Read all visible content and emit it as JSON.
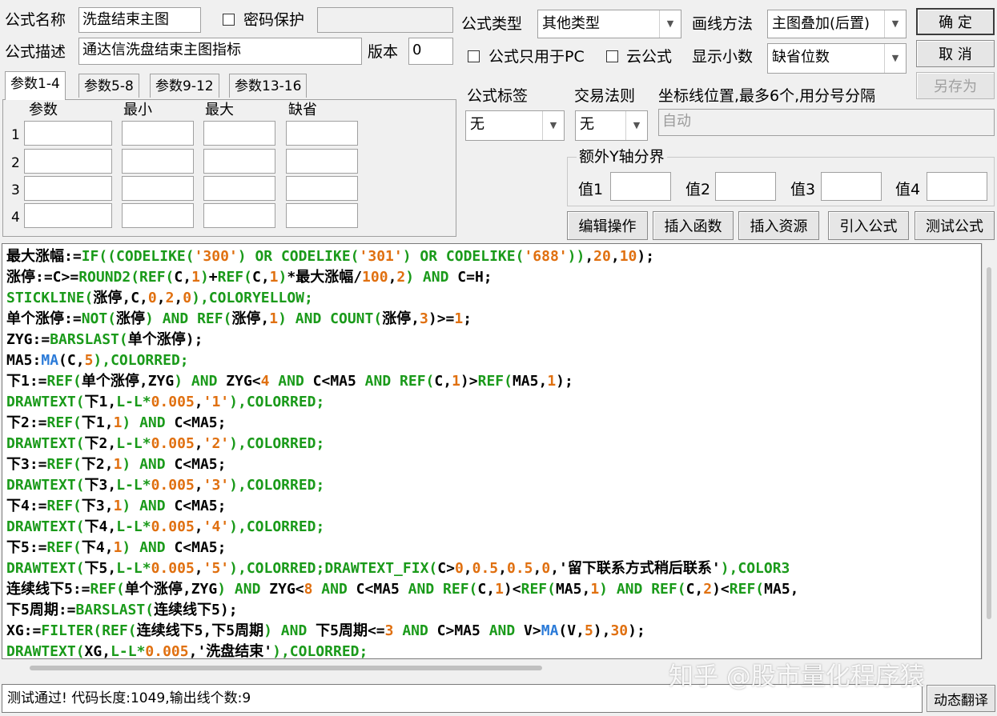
{
  "header": {
    "name_label": "公式名称",
    "name_value": "洗盘结束主图",
    "password_label": "密码保护",
    "password_value": "",
    "type_label": "公式类型",
    "type_value": "其他类型",
    "draw_label": "画线方法",
    "draw_value": "主图叠加(后置)",
    "desc_label": "公式描述",
    "desc_value": "通达信洗盘结束主图指标",
    "version_label": "版本",
    "version_value": "0",
    "pc_only_label": "公式只用于PC",
    "cloud_label": "云公式",
    "decimals_label": "显示小数",
    "decimals_value": "缺省位数"
  },
  "buttons": {
    "ok": "确  定",
    "cancel": "取  消",
    "save_as": "另存为",
    "edit_ops": "编辑操作",
    "insert_func": "插入函数",
    "insert_res": "插入资源",
    "import_formula": "引入公式",
    "test_formula": "测试公式",
    "translate": "动态翻译"
  },
  "tabs": [
    {
      "label": "参数1-4"
    },
    {
      "label": "参数5-8"
    },
    {
      "label": "参数9-12"
    },
    {
      "label": "参数13-16"
    }
  ],
  "params": {
    "headers": [
      "参数",
      "最小",
      "最大",
      "缺省"
    ],
    "rows": [
      "1",
      "2",
      "3",
      "4"
    ]
  },
  "tag": {
    "label": "公式标签",
    "value": "无"
  },
  "rule": {
    "label": "交易法则",
    "value": "无"
  },
  "coord": {
    "label": "坐标线位置,最多6个,用分号分隔",
    "value": "自动"
  },
  "yaxis": {
    "label": "额外Y轴分界",
    "v1": "值1",
    "v2": "值2",
    "v3": "值3",
    "v4": "值4"
  },
  "code_lines": [
    [
      [
        "t",
        "最大涨幅:="
      ],
      [
        "g",
        "IF(("
      ],
      [
        "g",
        "CODELIKE("
      ],
      [
        "o",
        "'300'"
      ],
      [
        "g",
        ") OR "
      ],
      [
        "g",
        "CODELIKE("
      ],
      [
        "o",
        "'301'"
      ],
      [
        "g",
        ") OR "
      ],
      [
        "g",
        "CODELIKE("
      ],
      [
        "o",
        "'688'"
      ],
      [
        "g",
        "))"
      ],
      [
        "t",
        ","
      ],
      [
        "o",
        "20"
      ],
      [
        "t",
        ","
      ],
      [
        "o",
        "10"
      ],
      [
        "t",
        ");"
      ]
    ],
    [
      [
        "t",
        "涨停:=C>="
      ],
      [
        "g",
        "ROUND2("
      ],
      [
        "g",
        "REF("
      ],
      [
        "t",
        "C,"
      ],
      [
        "o",
        "1"
      ],
      [
        "g",
        ")"
      ],
      [
        "t",
        "+"
      ],
      [
        "g",
        "REF("
      ],
      [
        "t",
        "C,"
      ],
      [
        "o",
        "1"
      ],
      [
        "g",
        ")"
      ],
      [
        "t",
        "*最大涨幅/"
      ],
      [
        "o",
        "100"
      ],
      [
        "t",
        ","
      ],
      [
        "o",
        "2"
      ],
      [
        "g",
        ") AND "
      ],
      [
        "t",
        "C=H;"
      ]
    ],
    [
      [
        "g",
        "STICKLINE("
      ],
      [
        "t",
        "涨停,C,"
      ],
      [
        "o",
        "0"
      ],
      [
        "t",
        ","
      ],
      [
        "o",
        "2"
      ],
      [
        "t",
        ","
      ],
      [
        "o",
        "0"
      ],
      [
        "g",
        "),COLORYELLOW;"
      ]
    ],
    [
      [
        "t",
        "单个涨停:="
      ],
      [
        "g",
        "NOT("
      ],
      [
        "t",
        "涨停"
      ],
      [
        "g",
        ") AND "
      ],
      [
        "g",
        "REF("
      ],
      [
        "t",
        "涨停,"
      ],
      [
        "o",
        "1"
      ],
      [
        "g",
        ") AND "
      ],
      [
        "g",
        "COUNT("
      ],
      [
        "t",
        "涨停,"
      ],
      [
        "o",
        "3"
      ],
      [
        "t",
        ")>="
      ],
      [
        "o",
        "1"
      ],
      [
        "t",
        ";"
      ]
    ],
    [
      [
        "t",
        "ZYG:="
      ],
      [
        "g",
        "BARSLAST("
      ],
      [
        "t",
        "单个涨停);"
      ]
    ],
    [
      [
        "t",
        "MA5:"
      ],
      [
        "b",
        "MA"
      ],
      [
        "t",
        "(C,"
      ],
      [
        "o",
        "5"
      ],
      [
        "g",
        "),COLORRED;"
      ]
    ],
    [
      [
        "t",
        "下1:="
      ],
      [
        "g",
        "REF("
      ],
      [
        "t",
        "单个涨停,ZYG"
      ],
      [
        "g",
        ") AND "
      ],
      [
        "t",
        "ZYG<"
      ],
      [
        "o",
        "4"
      ],
      [
        "g",
        " AND "
      ],
      [
        "t",
        "C<MA5"
      ],
      [
        "g",
        " AND "
      ],
      [
        "g",
        "REF("
      ],
      [
        "t",
        "C,"
      ],
      [
        "o",
        "1"
      ],
      [
        "t",
        ")>"
      ],
      [
        "g",
        "REF("
      ],
      [
        "t",
        "MA5,"
      ],
      [
        "o",
        "1"
      ],
      [
        "t",
        ");"
      ]
    ],
    [
      [
        "g",
        "DRAWTEXT("
      ],
      [
        "t",
        "下1,"
      ],
      [
        "g",
        "L-L*"
      ],
      [
        "o",
        "0.005"
      ],
      [
        "t",
        ","
      ],
      [
        "o",
        "'1'"
      ],
      [
        "g",
        "),COLORRED;"
      ]
    ],
    [
      [
        "t",
        "下2:="
      ],
      [
        "g",
        "REF("
      ],
      [
        "t",
        "下1,"
      ],
      [
        "o",
        "1"
      ],
      [
        "g",
        ") AND "
      ],
      [
        "t",
        "C<MA5;"
      ]
    ],
    [
      [
        "g",
        "DRAWTEXT("
      ],
      [
        "t",
        "下2,"
      ],
      [
        "g",
        "L-L*"
      ],
      [
        "o",
        "0.005"
      ],
      [
        "t",
        ","
      ],
      [
        "o",
        "'2'"
      ],
      [
        "g",
        "),COLORRED;"
      ]
    ],
    [
      [
        "t",
        "下3:="
      ],
      [
        "g",
        "REF("
      ],
      [
        "t",
        "下2,"
      ],
      [
        "o",
        "1"
      ],
      [
        "g",
        ") AND "
      ],
      [
        "t",
        "C<MA5;"
      ]
    ],
    [
      [
        "g",
        "DRAWTEXT("
      ],
      [
        "t",
        "下3,"
      ],
      [
        "g",
        "L-L*"
      ],
      [
        "o",
        "0.005"
      ],
      [
        "t",
        ","
      ],
      [
        "o",
        "'3'"
      ],
      [
        "g",
        "),COLORRED;"
      ]
    ],
    [
      [
        "t",
        "下4:="
      ],
      [
        "g",
        "REF("
      ],
      [
        "t",
        "下3,"
      ],
      [
        "o",
        "1"
      ],
      [
        "g",
        ") AND "
      ],
      [
        "t",
        "C<MA5;"
      ]
    ],
    [
      [
        "g",
        "DRAWTEXT("
      ],
      [
        "t",
        "下4,"
      ],
      [
        "g",
        "L-L*"
      ],
      [
        "o",
        "0.005"
      ],
      [
        "t",
        ","
      ],
      [
        "o",
        "'4'"
      ],
      [
        "g",
        "),COLORRED;"
      ]
    ],
    [
      [
        "t",
        "下5:="
      ],
      [
        "g",
        "REF("
      ],
      [
        "t",
        "下4,"
      ],
      [
        "o",
        "1"
      ],
      [
        "g",
        ") AND "
      ],
      [
        "t",
        "C<MA5;"
      ]
    ],
    [
      [
        "g",
        "DRAWTEXT("
      ],
      [
        "t",
        "下5,"
      ],
      [
        "g",
        "L-L*"
      ],
      [
        "o",
        "0.005"
      ],
      [
        "t",
        ","
      ],
      [
        "o",
        "'5'"
      ],
      [
        "g",
        "),COLORRED;"
      ],
      [
        "g",
        "DRAWTEXT_FIX("
      ],
      [
        "t",
        "C>"
      ],
      [
        "o",
        "0"
      ],
      [
        "t",
        ","
      ],
      [
        "o",
        "0.5"
      ],
      [
        "t",
        ","
      ],
      [
        "o",
        "0.5"
      ],
      [
        "t",
        ","
      ],
      [
        "o",
        "0"
      ],
      [
        "t",
        ",'留下联系方式稍后联系'"
      ],
      [
        "g",
        "),COLOR3"
      ]
    ],
    [
      [
        "t",
        "连续线下5:="
      ],
      [
        "g",
        "REF("
      ],
      [
        "t",
        "单个涨停,ZYG"
      ],
      [
        "g",
        ") AND "
      ],
      [
        "t",
        "ZYG<"
      ],
      [
        "o",
        "8"
      ],
      [
        "g",
        " AND "
      ],
      [
        "t",
        "C<MA5"
      ],
      [
        "g",
        " AND "
      ],
      [
        "g",
        "REF("
      ],
      [
        "t",
        "C,"
      ],
      [
        "o",
        "1"
      ],
      [
        "t",
        ")<"
      ],
      [
        "g",
        "REF("
      ],
      [
        "t",
        "MA5,"
      ],
      [
        "o",
        "1"
      ],
      [
        "g",
        ") AND "
      ],
      [
        "g",
        "REF("
      ],
      [
        "t",
        "C,"
      ],
      [
        "o",
        "2"
      ],
      [
        "t",
        ")<"
      ],
      [
        "g",
        "REF("
      ],
      [
        "t",
        "MA5,"
      ]
    ],
    [
      [
        "t",
        "下5周期:="
      ],
      [
        "g",
        "BARSLAST("
      ],
      [
        "t",
        "连续线下5);"
      ]
    ],
    [
      [
        "t",
        "XG:="
      ],
      [
        "g",
        "FILTER("
      ],
      [
        "g",
        "REF("
      ],
      [
        "t",
        "连续线下5,下5周期"
      ],
      [
        "g",
        ") AND "
      ],
      [
        "t",
        "下5周期<="
      ],
      [
        "o",
        "3"
      ],
      [
        "g",
        " AND "
      ],
      [
        "t",
        "C>MA5"
      ],
      [
        "g",
        " AND "
      ],
      [
        "t",
        "V>"
      ],
      [
        "b",
        "MA"
      ],
      [
        "t",
        "(V,"
      ],
      [
        "o",
        "5"
      ],
      [
        "t",
        "),"
      ],
      [
        "o",
        "30"
      ],
      [
        "t",
        ");"
      ]
    ],
    [
      [
        "g",
        "DRAWTEXT("
      ],
      [
        "t",
        "XG,"
      ],
      [
        "g",
        "L-L*"
      ],
      [
        "o",
        "0.005"
      ],
      [
        "t",
        ",'洗盘结束'"
      ],
      [
        "g",
        "),COLORRED;"
      ]
    ]
  ],
  "code_colors": {
    "t": "#000000",
    "g": "#1a9a1a",
    "o": "#e07010",
    "b": "#2a7ad8"
  },
  "status_text": "测试通过! 代码长度:1049,输出线个数:9",
  "watermark": "知乎 @股市量化程序猿"
}
